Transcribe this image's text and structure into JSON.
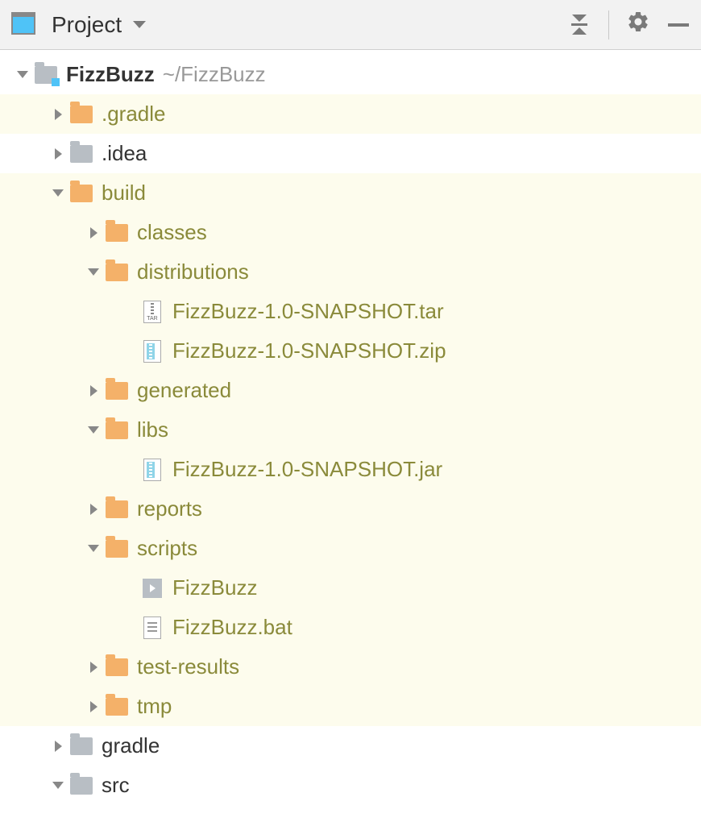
{
  "toolbar": {
    "title": "Project"
  },
  "tree": [
    {
      "depth": 0,
      "chev": "down",
      "icon": "module",
      "label": "FizzBuzz",
      "bold": true,
      "path": "~/FizzBuzz",
      "hl": false
    },
    {
      "depth": 1,
      "chev": "right",
      "icon": "folder-orange",
      "label": ".gradle",
      "olive": true,
      "hl": true
    },
    {
      "depth": 1,
      "chev": "right",
      "icon": "folder-gray",
      "label": ".idea",
      "hl": false
    },
    {
      "depth": 1,
      "chev": "down",
      "icon": "folder-orange",
      "label": "build",
      "olive": true,
      "hl": true
    },
    {
      "depth": 2,
      "chev": "right",
      "icon": "folder-orange",
      "label": "classes",
      "olive": true,
      "hl": true
    },
    {
      "depth": 2,
      "chev": "down",
      "icon": "folder-orange",
      "label": "distributions",
      "olive": true,
      "hl": true
    },
    {
      "depth": 3,
      "chev": "none",
      "icon": "tar",
      "label": "FizzBuzz-1.0-SNAPSHOT.tar",
      "olive": true,
      "hl": true
    },
    {
      "depth": 3,
      "chev": "none",
      "icon": "zip",
      "label": "FizzBuzz-1.0-SNAPSHOT.zip",
      "olive": true,
      "hl": true
    },
    {
      "depth": 2,
      "chev": "right",
      "icon": "folder-orange",
      "label": "generated",
      "olive": true,
      "hl": true
    },
    {
      "depth": 2,
      "chev": "down",
      "icon": "folder-orange",
      "label": "libs",
      "olive": true,
      "hl": true
    },
    {
      "depth": 3,
      "chev": "none",
      "icon": "zip",
      "label": "FizzBuzz-1.0-SNAPSHOT.jar",
      "olive": true,
      "hl": true
    },
    {
      "depth": 2,
      "chev": "right",
      "icon": "folder-orange",
      "label": "reports",
      "olive": true,
      "hl": true
    },
    {
      "depth": 2,
      "chev": "down",
      "icon": "folder-orange",
      "label": "scripts",
      "olive": true,
      "hl": true
    },
    {
      "depth": 3,
      "chev": "none",
      "icon": "script",
      "label": "FizzBuzz",
      "olive": true,
      "hl": true
    },
    {
      "depth": 3,
      "chev": "none",
      "icon": "text",
      "label": "FizzBuzz.bat",
      "olive": true,
      "hl": true
    },
    {
      "depth": 2,
      "chev": "right",
      "icon": "folder-orange",
      "label": "test-results",
      "olive": true,
      "hl": true
    },
    {
      "depth": 2,
      "chev": "right",
      "icon": "folder-orange",
      "label": "tmp",
      "olive": true,
      "hl": true
    },
    {
      "depth": 1,
      "chev": "right",
      "icon": "folder-gray",
      "label": "gradle",
      "hl": false
    },
    {
      "depth": 1,
      "chev": "down",
      "icon": "folder-gray",
      "label": "src",
      "hl": false
    }
  ]
}
